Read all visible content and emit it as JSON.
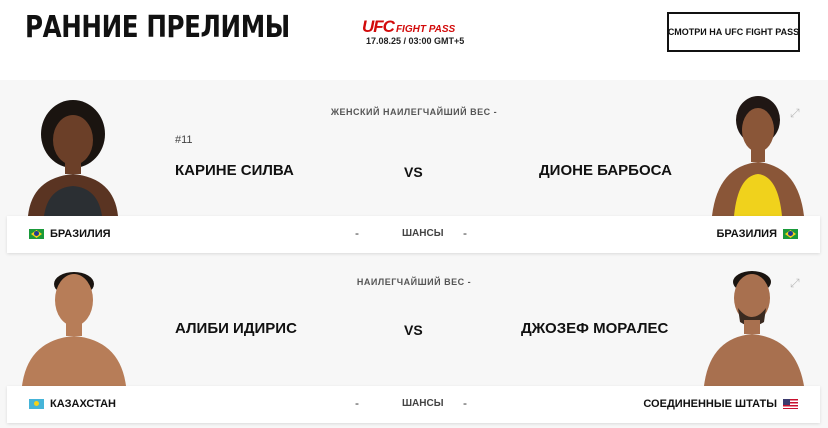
{
  "header": {
    "title": "РАННИЕ ПРЕЛИМЫ",
    "brand_ufc": "UFC",
    "brand_fightpass": "FIGHT PASS",
    "date_time": "17.08.25 / 03:00 GMT+5",
    "watch_button": "СМОТРИ НА UFC FIGHT PASS"
  },
  "fights": [
    {
      "weight_class": "ЖЕНСКИЙ НАИЛЕГЧАЙШИЙ ВЕС -",
      "red_rank": "#11",
      "red_name": "КАРИНЕ СИЛВА",
      "vs": "VS",
      "blue_name": "ДИОНЕ БАРБОСА",
      "red_country": "БРАЗИЛИЯ",
      "blue_country": "БРАЗИЛИЯ",
      "red_odds": "-",
      "odds_label": "ШАНСЫ",
      "blue_odds": "-",
      "red_flag": "brazil-flag",
      "blue_flag": "brazil-flag"
    },
    {
      "weight_class": "НАИЛЕГЧАЙШИЙ ВЕС -",
      "red_name": "АЛИБИ ИДИРИС",
      "vs": "VS",
      "blue_name": "ДЖОЗЕФ МОРАЛЕС",
      "red_country": "КАЗАХСТАН",
      "blue_country": "СОЕДИНЕННЫЕ ШТАТЫ",
      "red_odds": "-",
      "odds_label": "ШАНСЫ",
      "blue_odds": "-",
      "red_flag": "kazakhstan-flag",
      "blue_flag": "usa-flag"
    }
  ],
  "colors": {
    "brand_red": "#d20a0a"
  }
}
